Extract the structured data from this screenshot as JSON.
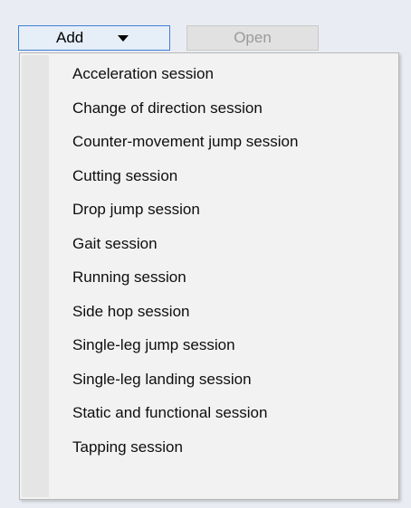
{
  "toolbar": {
    "add_label": "Add",
    "open_label": "Open"
  },
  "menu": {
    "items": [
      {
        "label": "Acceleration session"
      },
      {
        "label": "Change of direction session"
      },
      {
        "label": "Counter-movement jump session"
      },
      {
        "label": "Cutting session"
      },
      {
        "label": "Drop jump session"
      },
      {
        "label": "Gait session"
      },
      {
        "label": "Running session"
      },
      {
        "label": "Side hop session"
      },
      {
        "label": "Single-leg jump session"
      },
      {
        "label": "Single-leg landing session"
      },
      {
        "label": "Static and functional session"
      },
      {
        "label": "Tapping session"
      }
    ]
  },
  "colors": {
    "background": "#e9edf3",
    "add_border": "#3e7fd6",
    "add_fill": "#e6eef8",
    "open_fill": "#e1e1e1",
    "open_text": "#9a9a9a",
    "menu_fill": "#f2f2f2",
    "menu_gutter": "#e5e5e5"
  }
}
